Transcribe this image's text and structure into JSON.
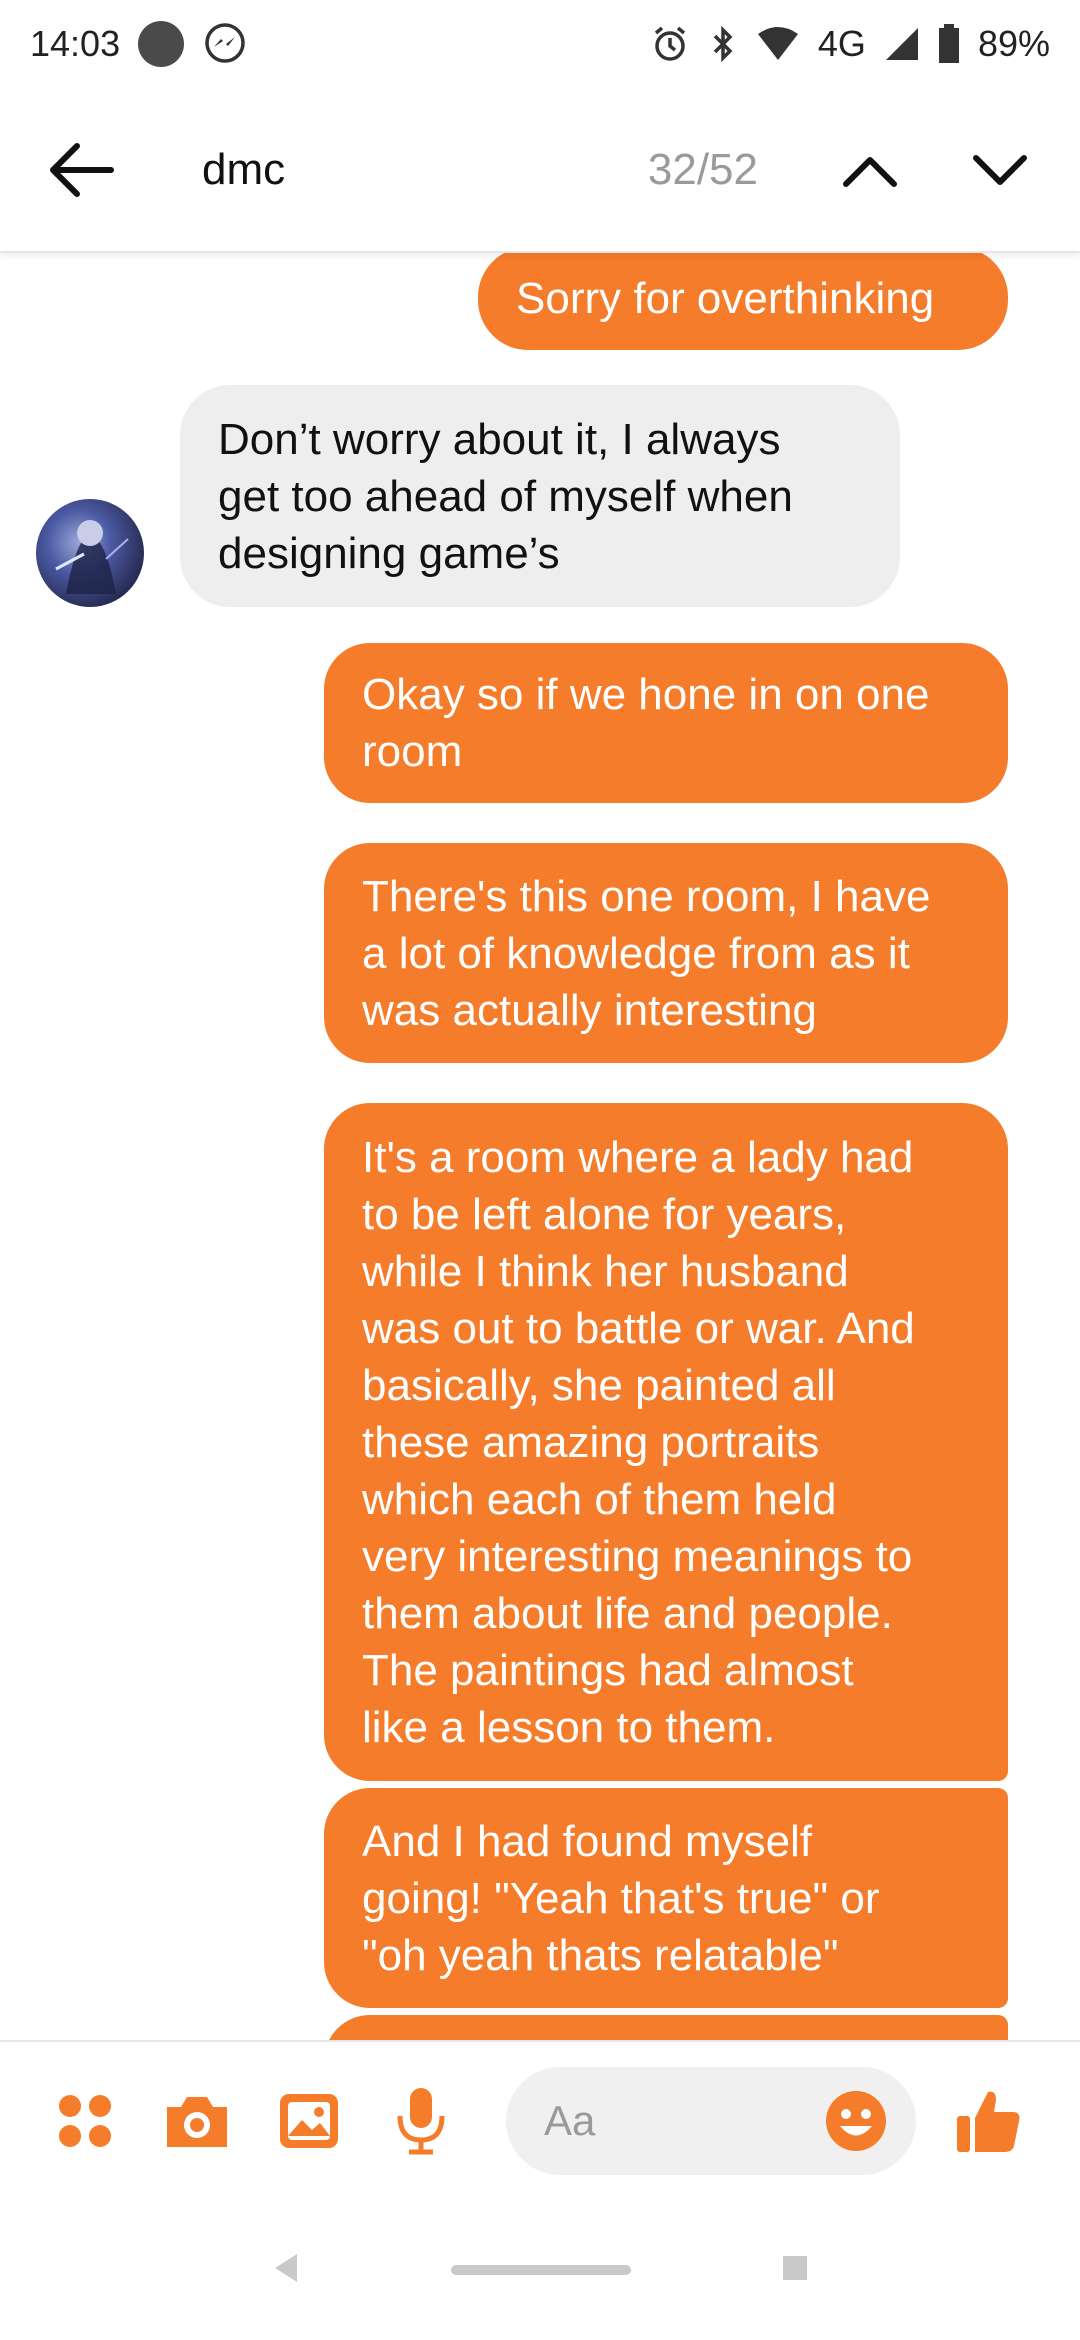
{
  "status_bar": {
    "time": "14:03",
    "network": "4G",
    "battery": "89%"
  },
  "header": {
    "search_query": "dmc",
    "result_count": "32/52"
  },
  "messages": [
    {
      "from": "me",
      "text": "Sorry for overthinking"
    },
    {
      "from": "them",
      "text": "Don’t worry about it, I always\nget too ahead of myself when\ndesigning game’s"
    },
    {
      "from": "me",
      "text": "Okay so if we hone in on one\nroom"
    },
    {
      "from": "me",
      "text": "There's this one room, I have\na lot of knowledge from as it\nwas actually interesting"
    },
    {
      "from": "me",
      "text": "It's a room where a lady had\nto be left alone for years,\nwhile I think her husband\nwas out to battle or war. And\nbasically, she painted all\nthese amazing portraits\nwhich each of them held\nvery interesting meanings to\nthem about life and people.\nThe paintings had almost\nlike a lesson to them."
    },
    {
      "from": "me",
      "text": "And I had found myself\ngoing! \"Yeah that's true\" or\n\"oh yeah thats relatable\""
    }
  ],
  "composer": {
    "placeholder": "Aa"
  },
  "colors": {
    "accent": "#f47c2a",
    "received_bubble": "#eeeeee"
  },
  "icons": [
    "back-arrow-icon",
    "chevron-up-icon",
    "chevron-down-icon",
    "apps-icon",
    "camera-icon",
    "gallery-icon",
    "microphone-icon",
    "emoji-icon",
    "thumbs-up-icon"
  ]
}
